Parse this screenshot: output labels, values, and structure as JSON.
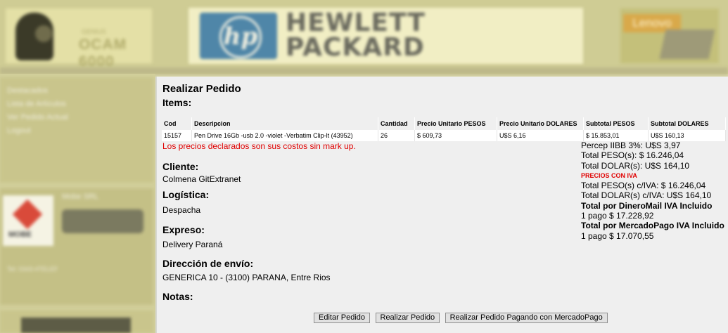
{
  "banner": {
    "webcam_ad_text": "OCAM 6000",
    "webcam_ad_small": "GENIUS",
    "hp_logo_text": "hp",
    "hp_line1": "HEWLETT",
    "hp_line2": "PACKARD",
    "lenovo_text": "Lenovo"
  },
  "sidebar": {
    "items": [
      {
        "label": "Destacados"
      },
      {
        "label": "Lista de Artículos"
      },
      {
        "label": "Ver Pedido Actual"
      },
      {
        "label": "Logout"
      }
    ],
    "partner_title": "Mobe SRL",
    "partner_logo_text": "MOBE",
    "partner_tel": "Tel: 0343-4TELEF"
  },
  "main": {
    "title": "Realizar Pedido",
    "items_label": "Items:",
    "table": {
      "headers": [
        "Cod",
        "Descripcion",
        "Cantidad",
        "Precio Unitario PESOS",
        "Precio Unitario DOLARES",
        "Subtotal PESOS",
        "Subtotal DOLARES"
      ],
      "rows": [
        [
          "15157",
          "Pen Drive 16Gb -usb 2.0 -violet -Verbatim Clip-lt (43952)",
          "26",
          "$ 609,73",
          "U$S 6,16",
          "$ 15.853,01",
          "U$S 160,13"
        ]
      ]
    },
    "note": "Los precios declarados son sus costos sin mark up.",
    "totals": {
      "percep": "Percep IIBB 3%: U$S 3,97",
      "total_pesos": "Total PESO(s): $ 16.246,04",
      "total_dolar": "Total DOLAR(s): U$S 164,10",
      "precios_con_iva": "PRECIOS CON IVA",
      "total_pesos_iva": "Total PESO(s) c/IVA: $ 16.246,04",
      "total_dolar_iva": "Total DOLAR(s) c/IVA: U$S 164,10",
      "dineromail_label": "Total por DineroMail IVA Incluido",
      "dineromail_value": "1 pago $ 17.228,92",
      "mercadopago_label": "Total por MercadoPago IVA Incluido",
      "mercadopago_value": "1 pago $ 17.070,55"
    },
    "cliente_label": "Cliente:",
    "cliente_value": "Colmena GitExtranet",
    "logistica_label": "Logística:",
    "logistica_value": "Despacha",
    "expreso_label": "Expreso:",
    "expreso_value": "Delivery Paraná",
    "direccion_label": "Dirección de envío:",
    "direccion_value": "GENERICA 10 - (3100) PARANA, Entre Rios",
    "notas_label": "Notas:",
    "buttons": {
      "editar": "Editar Pedido",
      "realizar": "Realizar Pedido",
      "mercadopago": "Realizar Pedido Pagando con MercadoPago"
    }
  }
}
